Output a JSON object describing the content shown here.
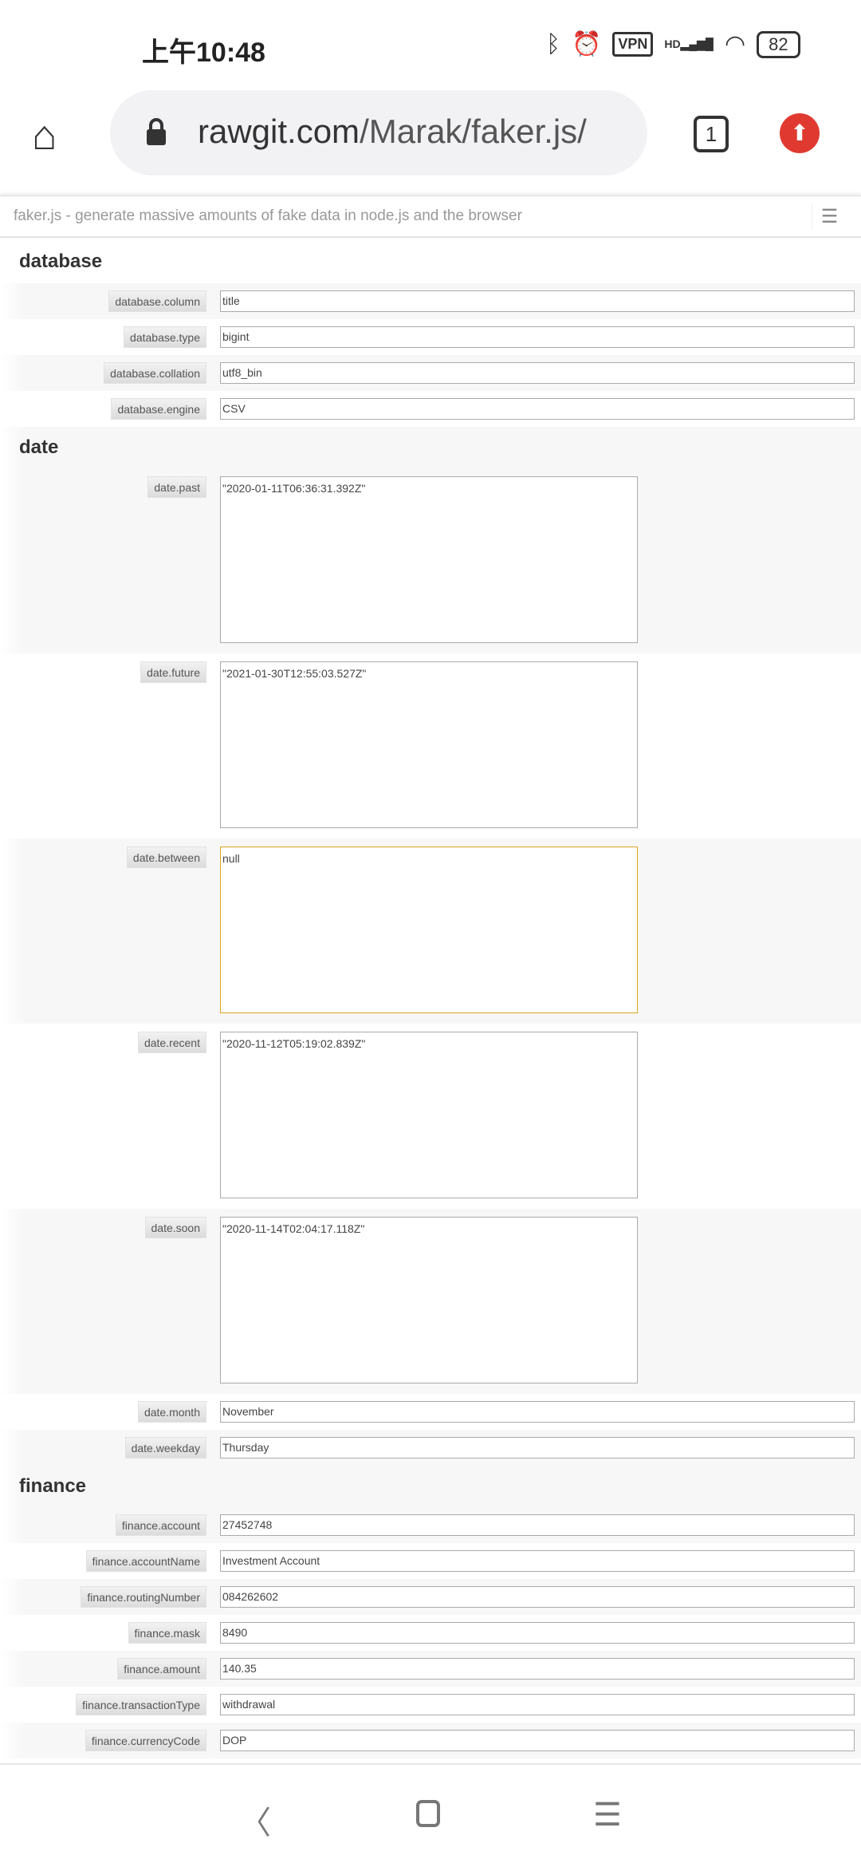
{
  "status": {
    "time": "上午10:48",
    "vpn": "VPN",
    "battery": "82",
    "network": "HD"
  },
  "browser": {
    "url_host": "rawgit.com",
    "url_path": "/Marak/faker.js/",
    "tab_count": "1"
  },
  "page": {
    "title": "faker.js - generate massive amounts of fake data in node.js and the browser"
  },
  "sections": [
    {
      "heading": "database",
      "fields": [
        {
          "label": "database.column",
          "value": "title"
        },
        {
          "label": "database.type",
          "value": "bigint"
        },
        {
          "label": "database.collation",
          "value": "utf8_bin"
        },
        {
          "label": "database.engine",
          "value": "CSV"
        }
      ]
    },
    {
      "heading": "date",
      "fields": [
        {
          "label": "date.past",
          "value": "\"2020-01-11T06:36:31.392Z\"",
          "multiline": true
        },
        {
          "label": "date.future",
          "value": "\"2021-01-30T12:55:03.527Z\"",
          "multiline": true
        },
        {
          "label": "date.between",
          "value": "null",
          "multiline": true,
          "focused": true
        },
        {
          "label": "date.recent",
          "value": "\"2020-11-12T05:19:02.839Z\"",
          "multiline": true
        },
        {
          "label": "date.soon",
          "value": "\"2020-11-14T02:04:17.118Z\"",
          "multiline": true
        },
        {
          "label": "date.month",
          "value": "November"
        },
        {
          "label": "date.weekday",
          "value": "Thursday"
        }
      ]
    },
    {
      "heading": "finance",
      "fields": [
        {
          "label": "finance.account",
          "value": "27452748"
        },
        {
          "label": "finance.accountName",
          "value": "Investment Account"
        },
        {
          "label": "finance.routingNumber",
          "value": "084262602"
        },
        {
          "label": "finance.mask",
          "value": "8490"
        },
        {
          "label": "finance.amount",
          "value": "140.35"
        },
        {
          "label": "finance.transactionType",
          "value": "withdrawal"
        },
        {
          "label": "finance.currencyCode",
          "value": "DOP"
        }
      ]
    }
  ],
  "colors": {
    "focus_border": "#d9a520",
    "update_button": "#e03a30"
  }
}
